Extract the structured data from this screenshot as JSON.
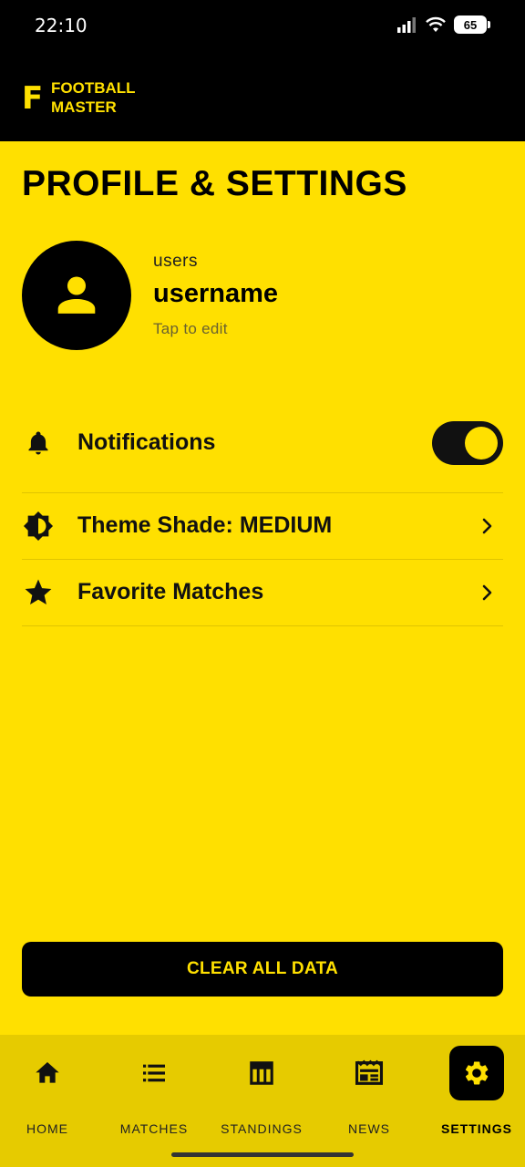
{
  "status_bar": {
    "time": "22:10",
    "battery": "65"
  },
  "app": {
    "logo_letter": "F",
    "name_line1": "FOOTBALL",
    "name_line2": "MASTER"
  },
  "page": {
    "title": "PROFILE & SETTINGS"
  },
  "profile": {
    "role": "users",
    "username": "username",
    "hint": "Tap to edit"
  },
  "settings": {
    "notifications": {
      "label": "Notifications",
      "enabled": true
    },
    "theme": {
      "label": "Theme Shade: MEDIUM"
    },
    "favorites": {
      "label": "Favorite Matches"
    }
  },
  "actions": {
    "clear_label": "CLEAR ALL DATA"
  },
  "nav": {
    "home": "HOME",
    "matches": "MATCHES",
    "standings": "STANDINGS",
    "news": "NEWS",
    "settings": "SETTINGS",
    "active": "settings"
  },
  "colors": {
    "accent": "#FFE000",
    "nav_bg": "#E6CB00",
    "dark": "#000000"
  }
}
